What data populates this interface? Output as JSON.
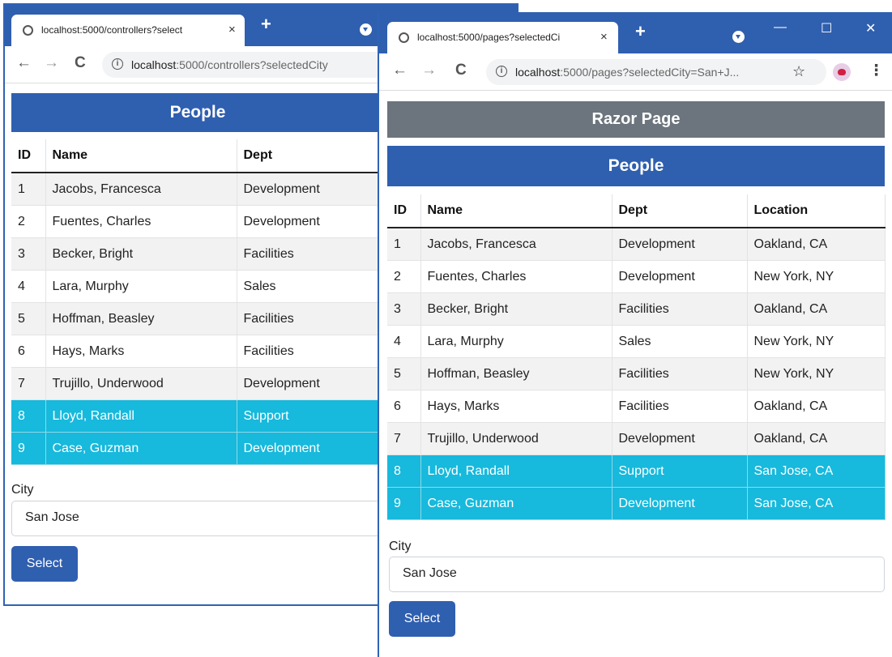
{
  "left_window": {
    "tab_title": "localhost:5000/controllers?select",
    "tab_close": "×",
    "new_tab": "+",
    "url_host": "localhost",
    "url_rest": ":5000/controllers?selectedCity",
    "header": "People",
    "columns": [
      "ID",
      "Name",
      "Dept"
    ],
    "rows": [
      [
        "1",
        "Jacobs, Francesca",
        "Development"
      ],
      [
        "2",
        "Fuentes, Charles",
        "Development"
      ],
      [
        "3",
        "Becker, Bright",
        "Facilities"
      ],
      [
        "4",
        "Lara, Murphy",
        "Sales"
      ],
      [
        "5",
        "Hoffman, Beasley",
        "Facilities"
      ],
      [
        "6",
        "Hays, Marks",
        "Facilities"
      ],
      [
        "7",
        "Trujillo, Underwood",
        "Development"
      ],
      [
        "8",
        "Lloyd, Randall",
        "Support"
      ],
      [
        "9",
        "Case, Guzman",
        "Development"
      ]
    ],
    "highlighted_rows": [
      8,
      9
    ],
    "city_label": "City",
    "city_value": "San Jose",
    "select_label": "Select"
  },
  "right_window": {
    "tab_title": "localhost:5000/pages?selectedCi",
    "tab_close": "×",
    "new_tab": "+",
    "url_host": "localhost",
    "url_rest": ":5000/pages?selectedCity=San+J...",
    "razor_header": "Razor Page",
    "header": "People",
    "columns": [
      "ID",
      "Name",
      "Dept",
      "Location"
    ],
    "rows": [
      [
        "1",
        "Jacobs, Francesca",
        "Development",
        "Oakland, CA"
      ],
      [
        "2",
        "Fuentes, Charles",
        "Development",
        "New York, NY"
      ],
      [
        "3",
        "Becker, Bright",
        "Facilities",
        "Oakland, CA"
      ],
      [
        "4",
        "Lara, Murphy",
        "Sales",
        "New York, NY"
      ],
      [
        "5",
        "Hoffman, Beasley",
        "Facilities",
        "New York, NY"
      ],
      [
        "6",
        "Hays, Marks",
        "Facilities",
        "Oakland, CA"
      ],
      [
        "7",
        "Trujillo, Underwood",
        "Development",
        "Oakland, CA"
      ],
      [
        "8",
        "Lloyd, Randall",
        "Support",
        "San Jose, CA"
      ],
      [
        "9",
        "Case, Guzman",
        "Development",
        "San Jose, CA"
      ]
    ],
    "highlighted_rows": [
      8,
      9
    ],
    "city_label": "City",
    "city_value": "San Jose",
    "select_label": "Select"
  },
  "icons": {
    "back": "←",
    "forward": "→",
    "reload": "C",
    "info": "i",
    "star": "☆",
    "menu": "⋮",
    "minimize": "—",
    "maximize": "☐",
    "close": "✕"
  },
  "colors": {
    "chrome_blue": "#2f5faf",
    "people_header": "#2f5faf",
    "razor_header": "#6c757d",
    "highlight_row": "#17b9dc",
    "button": "#2f5faf"
  }
}
